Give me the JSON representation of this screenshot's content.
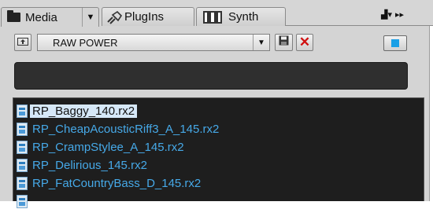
{
  "tabs": [
    {
      "label": "Media",
      "icon": "folder-icon",
      "active": true
    },
    {
      "label": "PlugIns",
      "icon": "plug-icon",
      "active": false
    },
    {
      "label": "Synth",
      "icon": "synth-icon",
      "active": false
    }
  ],
  "toolbar": {
    "preset_value": "RAW POWER",
    "up_icon": "folder-up-icon",
    "save_icon": "save-icon",
    "delete_icon": "close-icon",
    "view_icon": "view-mode-icon"
  },
  "search": {
    "value": ""
  },
  "files": [
    {
      "name": "RP_Baggy_140.rx2",
      "selected": true
    },
    {
      "name": "RP_CheapAcousticRiff3_A_145.rx2",
      "selected": false
    },
    {
      "name": "RP_CrampStylee_A_145.rx2",
      "selected": false
    },
    {
      "name": "RP_Delirious_145.rx2",
      "selected": false
    },
    {
      "name": "RP_FatCountryBass_D_145.rx2",
      "selected": false
    }
  ],
  "colors": {
    "accent": "#1aa0e6",
    "file_text": "#46a9e8",
    "selection": "#d6e8f8",
    "delete": "#d01010"
  }
}
